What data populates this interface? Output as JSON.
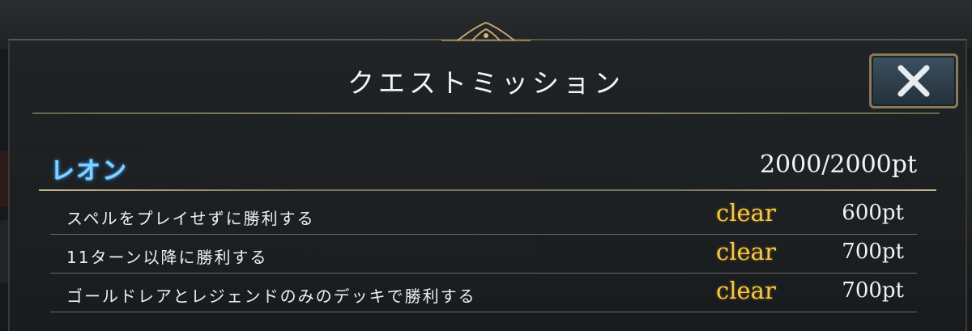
{
  "modal": {
    "title": "クエストミッション",
    "close_icon": "close-icon"
  },
  "character": {
    "name": "レオン",
    "total_points": "2000/2000pt"
  },
  "missions": [
    {
      "label": "スペルをプレイせずに勝利する",
      "status": "clear",
      "points": "600pt"
    },
    {
      "label": "11ターン以降に勝利する",
      "status": "clear",
      "points": "700pt"
    },
    {
      "label": "ゴールドレアとレジェンドのみのデッキで勝利する",
      "status": "clear",
      "points": "700pt"
    }
  ],
  "colors": {
    "character_name": "#7fd3ff",
    "clear_status": "#f5c84a",
    "border_gold": "#8a7a55"
  }
}
